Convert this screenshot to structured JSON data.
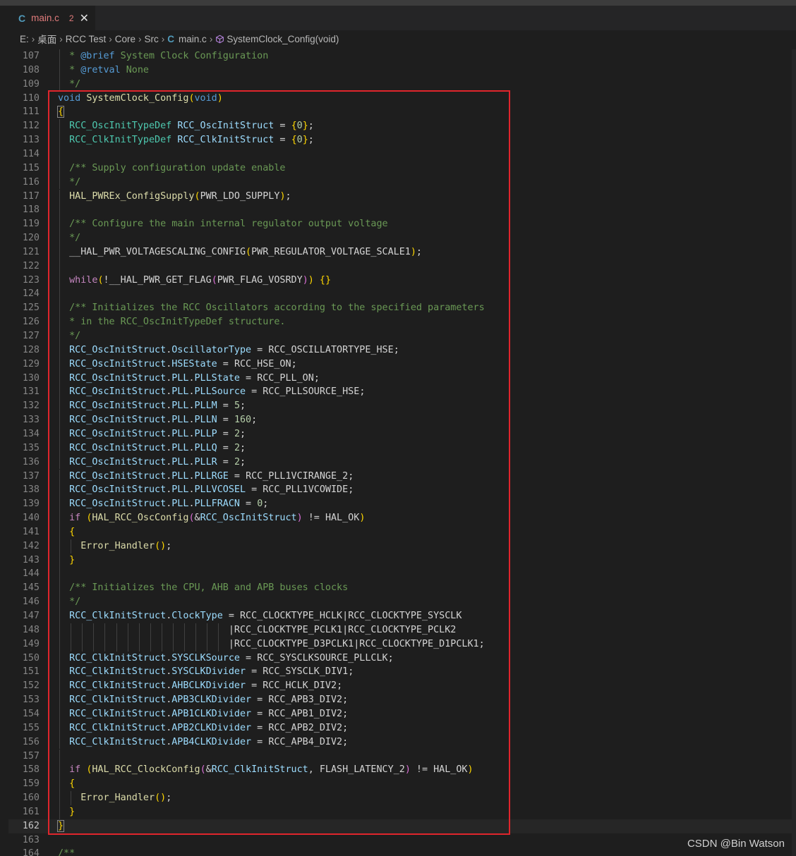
{
  "tab": {
    "icon": "C",
    "name": "main.c",
    "problems": "2",
    "close": "✕"
  },
  "breadcrumb": {
    "items": [
      "E:",
      "桌面",
      "RCC Test",
      "Core",
      "Src"
    ],
    "file_icon": "C",
    "file": "main.c",
    "symbol": "SystemClock_Config(void)"
  },
  "watermark": "CSDN @Bin Watson",
  "current_line": 162,
  "lines": [
    {
      "n": "107",
      "t": "  * @brief System Clock Configuration"
    },
    {
      "n": "108",
      "t": "  * @retval None"
    },
    {
      "n": "109",
      "t": "  */"
    },
    {
      "n": "110",
      "t": "void SystemClock_Config(void)"
    },
    {
      "n": "111",
      "t": "{"
    },
    {
      "n": "112",
      "t": "  RCC_OscInitTypeDef RCC_OscInitStruct = {0};"
    },
    {
      "n": "113",
      "t": "  RCC_ClkInitTypeDef RCC_ClkInitStruct = {0};"
    },
    {
      "n": "114",
      "t": ""
    },
    {
      "n": "115",
      "t": "  /** Supply configuration update enable"
    },
    {
      "n": "116",
      "t": "  */"
    },
    {
      "n": "117",
      "t": "  HAL_PWREx_ConfigSupply(PWR_LDO_SUPPLY);"
    },
    {
      "n": "118",
      "t": ""
    },
    {
      "n": "119",
      "t": "  /** Configure the main internal regulator output voltage"
    },
    {
      "n": "120",
      "t": "  */"
    },
    {
      "n": "121",
      "t": "  __HAL_PWR_VOLTAGESCALING_CONFIG(PWR_REGULATOR_VOLTAGE_SCALE1);"
    },
    {
      "n": "122",
      "t": ""
    },
    {
      "n": "123",
      "t": "  while(!__HAL_PWR_GET_FLAG(PWR_FLAG_VOSRDY)) {}"
    },
    {
      "n": "124",
      "t": ""
    },
    {
      "n": "125",
      "t": "  /** Initializes the RCC Oscillators according to the specified parameters"
    },
    {
      "n": "126",
      "t": "  * in the RCC_OscInitTypeDef structure."
    },
    {
      "n": "127",
      "t": "  */"
    },
    {
      "n": "128",
      "t": "  RCC_OscInitStruct.OscillatorType = RCC_OSCILLATORTYPE_HSE;"
    },
    {
      "n": "129",
      "t": "  RCC_OscInitStruct.HSEState = RCC_HSE_ON;"
    },
    {
      "n": "130",
      "t": "  RCC_OscInitStruct.PLL.PLLState = RCC_PLL_ON;"
    },
    {
      "n": "131",
      "t": "  RCC_OscInitStruct.PLL.PLLSource = RCC_PLLSOURCE_HSE;"
    },
    {
      "n": "132",
      "t": "  RCC_OscInitStruct.PLL.PLLM = 5;"
    },
    {
      "n": "133",
      "t": "  RCC_OscInitStruct.PLL.PLLN = 160;"
    },
    {
      "n": "134",
      "t": "  RCC_OscInitStruct.PLL.PLLP = 2;"
    },
    {
      "n": "135",
      "t": "  RCC_OscInitStruct.PLL.PLLQ = 2;"
    },
    {
      "n": "136",
      "t": "  RCC_OscInitStruct.PLL.PLLR = 2;"
    },
    {
      "n": "137",
      "t": "  RCC_OscInitStruct.PLL.PLLRGE = RCC_PLL1VCIRANGE_2;"
    },
    {
      "n": "138",
      "t": "  RCC_OscInitStruct.PLL.PLLVCOSEL = RCC_PLL1VCOWIDE;"
    },
    {
      "n": "139",
      "t": "  RCC_OscInitStruct.PLL.PLLFRACN = 0;"
    },
    {
      "n": "140",
      "t": "  if (HAL_RCC_OscConfig(&RCC_OscInitStruct) != HAL_OK)"
    },
    {
      "n": "141",
      "t": "  {"
    },
    {
      "n": "142",
      "t": "    Error_Handler();"
    },
    {
      "n": "143",
      "t": "  }"
    },
    {
      "n": "144",
      "t": ""
    },
    {
      "n": "145",
      "t": "  /** Initializes the CPU, AHB and APB buses clocks"
    },
    {
      "n": "146",
      "t": "  */"
    },
    {
      "n": "147",
      "t": "  RCC_ClkInitStruct.ClockType = RCC_CLOCKTYPE_HCLK|RCC_CLOCKTYPE_SYSCLK"
    },
    {
      "n": "148",
      "t": "                              |RCC_CLOCKTYPE_PCLK1|RCC_CLOCKTYPE_PCLK2"
    },
    {
      "n": "149",
      "t": "                              |RCC_CLOCKTYPE_D3PCLK1|RCC_CLOCKTYPE_D1PCLK1;"
    },
    {
      "n": "150",
      "t": "  RCC_ClkInitStruct.SYSCLKSource = RCC_SYSCLKSOURCE_PLLCLK;"
    },
    {
      "n": "151",
      "t": "  RCC_ClkInitStruct.SYSCLKDivider = RCC_SYSCLK_DIV1;"
    },
    {
      "n": "152",
      "t": "  RCC_ClkInitStruct.AHBCLKDivider = RCC_HCLK_DIV2;"
    },
    {
      "n": "153",
      "t": "  RCC_ClkInitStruct.APB3CLKDivider = RCC_APB3_DIV2;"
    },
    {
      "n": "154",
      "t": "  RCC_ClkInitStruct.APB1CLKDivider = RCC_APB1_DIV2;"
    },
    {
      "n": "155",
      "t": "  RCC_ClkInitStruct.APB2CLKDivider = RCC_APB2_DIV2;"
    },
    {
      "n": "156",
      "t": "  RCC_ClkInitStruct.APB4CLKDivider = RCC_APB4_DIV2;"
    },
    {
      "n": "157",
      "t": ""
    },
    {
      "n": "158",
      "t": "  if (HAL_RCC_ClockConfig(&RCC_ClkInitStruct, FLASH_LATENCY_2) != HAL_OK)"
    },
    {
      "n": "159",
      "t": "  {"
    },
    {
      "n": "160",
      "t": "    Error_Handler();"
    },
    {
      "n": "161",
      "t": "  }"
    },
    {
      "n": "162",
      "t": "}"
    },
    {
      "n": "163",
      "t": ""
    },
    {
      "n": "164",
      "t": "/**"
    }
  ]
}
